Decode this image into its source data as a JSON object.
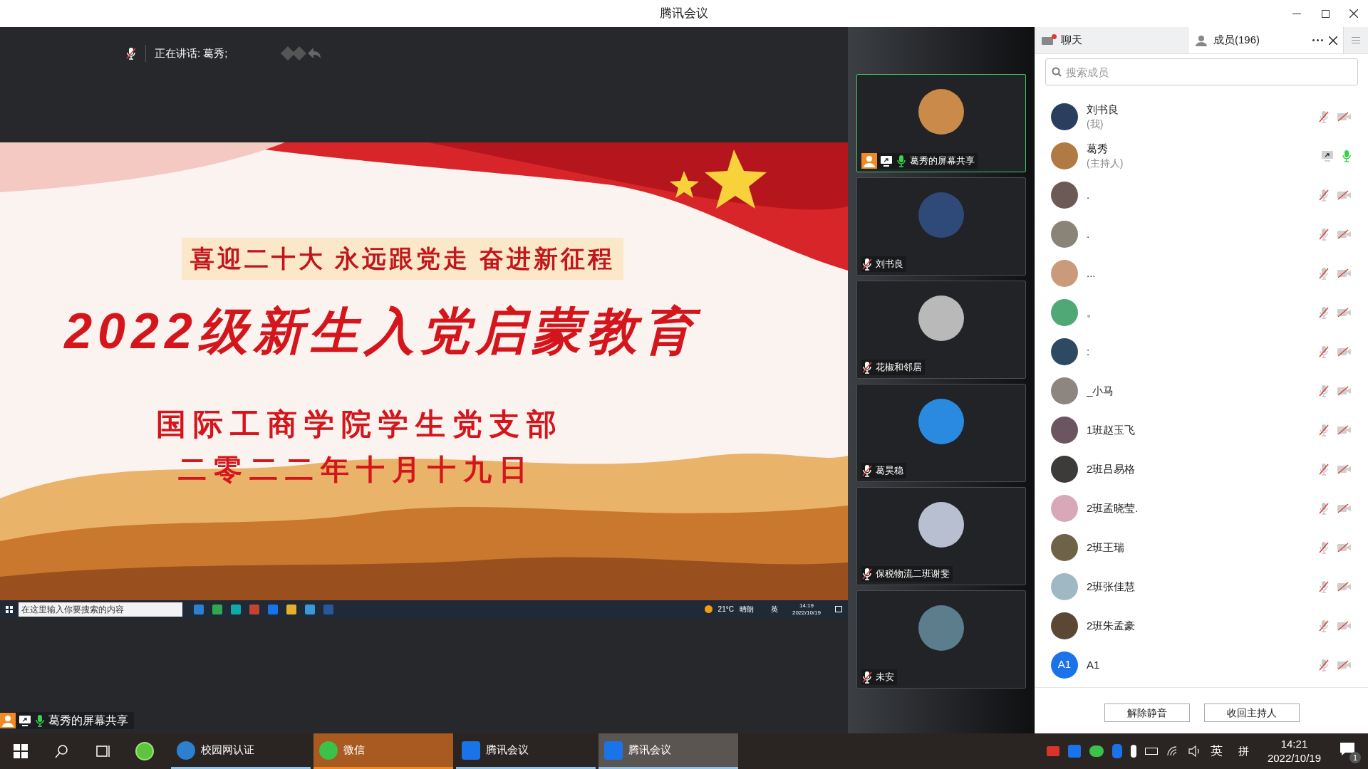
{
  "window": {
    "title": "腾讯会议"
  },
  "speaking_bar": {
    "label": "正在讲话: 葛秀;"
  },
  "slide": {
    "banner": "喜迎二十大 永远跟党走 奋进新征程",
    "title": "2022级新生入党启蒙教育",
    "org": "国际工商学院学生党支部",
    "date": "二零二二年十月十九日"
  },
  "shared_taskbar": {
    "search_placeholder": "在这里输入你要搜索的内容",
    "weather": "21°C",
    "weather_text": "晴朗",
    "ime": "英",
    "time": "14:19",
    "date": "2022/10/19"
  },
  "share_label": {
    "label": "葛秀的屏幕共享"
  },
  "thumbnails": [
    {
      "name": "葛秀的屏幕共享",
      "speaking": true,
      "mic_on": true,
      "color": "#c98a4a"
    },
    {
      "name": "刘书良",
      "speaking": false,
      "mic_on": false,
      "color": "#2f4a78"
    },
    {
      "name": "花椒和邻居",
      "speaking": false,
      "mic_on": false,
      "color": "#b9b9b9"
    },
    {
      "name": "葛昊稳",
      "speaking": false,
      "mic_on": false,
      "color": "#2a8ae0"
    },
    {
      "name": "保税物流二班谢斐",
      "speaking": false,
      "mic_on": false,
      "color": "#b8bfd0"
    },
    {
      "name": "未安",
      "speaking": false,
      "mic_on": false,
      "color": "#5b7d8c"
    }
  ],
  "panel": {
    "tabs": [
      {
        "label": "聊天",
        "selected": false,
        "unread": true
      },
      {
        "label": "成员(196)",
        "selected": true,
        "unread": false
      }
    ],
    "search": {
      "placeholder": "搜索成员"
    },
    "members": [
      {
        "name": "刘书良",
        "role": "(我)",
        "kind": "self",
        "mic_on": false,
        "color": "#2c3e5e"
      },
      {
        "name": "葛秀",
        "role": "(主持人)",
        "kind": "host",
        "mic_on": true,
        "color": "#b07a44"
      },
      {
        "name": ".",
        "kind": "member",
        "mic_on": false,
        "color": "#6b5a55"
      },
      {
        "name": ".",
        "kind": "member",
        "mic_on": false,
        "color": "#8a8478"
      },
      {
        "name": "...",
        "kind": "member",
        "mic_on": false,
        "color": "#c99b7a"
      },
      {
        "name": "。",
        "kind": "member",
        "mic_on": false,
        "color": "#4fa876"
      },
      {
        "name": ":",
        "kind": "member",
        "mic_on": false,
        "color": "#2e4a62"
      },
      {
        "name": "_小马",
        "kind": "member",
        "mic_on": false,
        "color": "#8d8580"
      },
      {
        "name": "1班赵玉飞",
        "kind": "member",
        "mic_on": false,
        "color": "#6b5560"
      },
      {
        "name": "2班吕易格",
        "kind": "member",
        "mic_on": false,
        "color": "#3d3a3a"
      },
      {
        "name": "2班孟晓莹.",
        "kind": "member",
        "mic_on": false,
        "color": "#d8a8b8"
      },
      {
        "name": "2班王瑞",
        "kind": "member",
        "mic_on": false,
        "color": "#6e6248"
      },
      {
        "name": "2班张佳慧",
        "kind": "member",
        "mic_on": false,
        "color": "#9fb8c4"
      },
      {
        "name": "2班朱孟豪",
        "kind": "member",
        "mic_on": false,
        "color": "#5c4634"
      },
      {
        "name": "A1",
        "initials": "A1",
        "kind": "initials",
        "mic_on": false,
        "color": "#1a73e8"
      }
    ],
    "buttons": [
      "解除静音",
      "收回主持人"
    ]
  },
  "taskbar": {
    "apps": [
      {
        "label": "校园网认证",
        "kind": "running"
      },
      {
        "label": "微信",
        "kind": "flashing"
      },
      {
        "label": "腾讯会议",
        "kind": "running"
      },
      {
        "label": "腾讯会议",
        "kind": "active"
      }
    ],
    "ime_lang": "英",
    "ime_mode": "拼",
    "time": "14:21",
    "date": "2022/10/19",
    "notifications": "1"
  }
}
